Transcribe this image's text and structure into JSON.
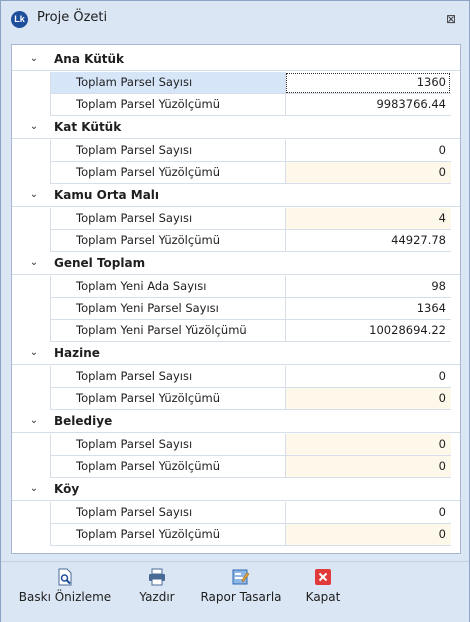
{
  "window": {
    "title": "Proje Özeti",
    "logo_text": "Lk",
    "close_glyph": "⊠"
  },
  "groups": [
    {
      "label": "Ana Kütük",
      "rows": [
        {
          "label": "Toplam Parsel Sayısı",
          "value": "1360"
        },
        {
          "label": "Toplam Parsel Yüzölçümü",
          "value": "9983766.44"
        }
      ]
    },
    {
      "label": "Kat Kütük",
      "rows": [
        {
          "label": "Toplam Parsel Sayısı",
          "value": "0"
        },
        {
          "label": "Toplam Parsel Yüzölçümü",
          "value": "0"
        }
      ]
    },
    {
      "label": "Kamu Orta Malı",
      "rows": [
        {
          "label": "Toplam Parsel Sayısı",
          "value": "4"
        },
        {
          "label": "Toplam Parsel Yüzölçümü",
          "value": "44927.78"
        }
      ]
    },
    {
      "label": "Genel Toplam",
      "rows": [
        {
          "label": "Toplam Yeni Ada Sayısı",
          "value": "98"
        },
        {
          "label": "Toplam Yeni Parsel Sayısı",
          "value": "1364"
        },
        {
          "label": "Toplam Yeni Parsel Yüzölçümü",
          "value": "10028694.22"
        }
      ]
    },
    {
      "label": "Hazine",
      "rows": [
        {
          "label": "Toplam Parsel Sayısı",
          "value": "0"
        },
        {
          "label": "Toplam Parsel Yüzölçümü",
          "value": "0"
        }
      ]
    },
    {
      "label": "Belediye",
      "rows": [
        {
          "label": "Toplam Parsel Sayısı",
          "value": "0"
        },
        {
          "label": "Toplam Parsel Yüzölçümü",
          "value": "0"
        }
      ]
    },
    {
      "label": "Köy",
      "rows": [
        {
          "label": "Toplam Parsel Sayısı",
          "value": "0"
        },
        {
          "label": "Toplam Parsel Yüzölçümü",
          "value": "0"
        }
      ]
    }
  ],
  "toolbar": {
    "preview_label": "Baskı Önizleme",
    "preview_icon": "print-preview-icon",
    "print_label": "Yazdır",
    "print_icon": "printer-icon",
    "design_label": "Rapor Tasarla",
    "design_icon": "report-design-icon",
    "close_label": "Kapat",
    "close_icon": "close-red-icon"
  },
  "colors": {
    "accent": "#1f4e9c",
    "close_red": "#e03a3a",
    "edit_cell": "#fdf8ea",
    "selected_row": "#d6e6f8"
  }
}
